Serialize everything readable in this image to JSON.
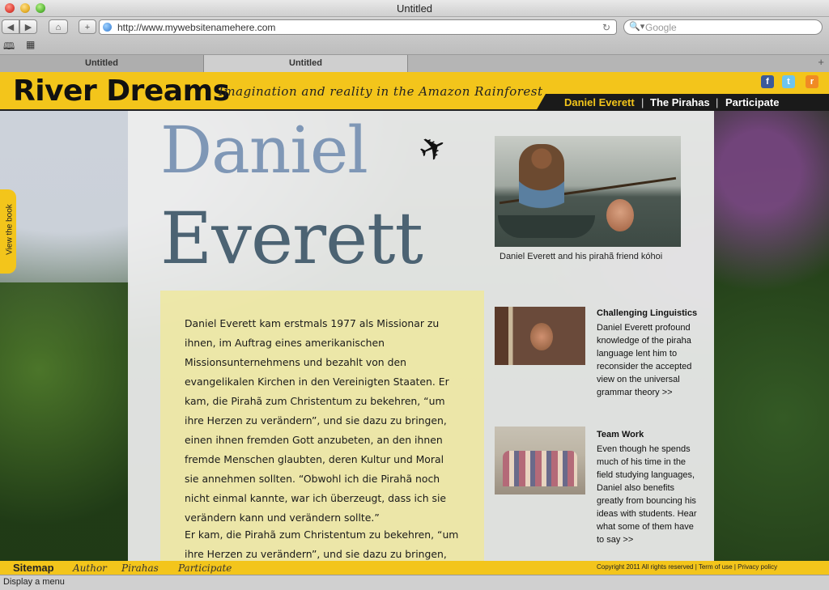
{
  "window": {
    "title": "Untitled"
  },
  "toolbar": {
    "back_icon": "back-arrow-icon",
    "forward_icon": "forward-arrow-icon",
    "home_icon": "home-icon",
    "add_icon": "plus-icon",
    "url": "http://www.mywebsitenamehere.com",
    "search_placeholder": "Google"
  },
  "tabs": [
    {
      "label": "Untitled"
    },
    {
      "label": "Untitled"
    }
  ],
  "site": {
    "logo": "River Dreams",
    "tagline": "Imagination and reality in the Amazon Rainforest",
    "social": {
      "facebook": "f",
      "twitter": "t",
      "rss": "r"
    },
    "nav": [
      {
        "label": "Daniel Everett",
        "color": "#f3c51b"
      },
      {
        "label": "The Pirahas",
        "color": "#ffffff"
      },
      {
        "label": "Participate",
        "color": "#ffffff"
      }
    ],
    "nav_separator": "|",
    "book_tab": "View the book"
  },
  "main": {
    "name_line1": "Daniel",
    "name_line2": "Everett",
    "paragraph1": "Daniel Everett kam erstmals 1977 als Missionar zu ihnen, im Auftrag eines amerikanischen Missionsunternehmens und bezahlt von den evangelikalen Kirchen in den Vereinigten Staaten. Er kam, die Pirahã zum Christentum zu bekehren, “um ihre Herzen zu verändern”, und sie dazu zu bringen, einen ihnen fremden Gott anzubeten, an den ihnen fremde Menschen glaubten, deren Kultur und Moral sie annehmen sollten. “Obwohl ich die Pirahã noch nicht einmal kannte, war ich überzeugt, dass ich sie verändern kann und verändern sollte.”",
    "paragraph2": "Er kam, die Pirahã zum Christentum zu bekehren, “um ihre Herzen zu verändern”, und sie dazu zu bringen, einen ihnen",
    "photo_caption": "Daniel Everett and his pirahã friend kóhoi",
    "sidebar": [
      {
        "title": "Challenging Linguistics",
        "text": "Daniel Everett profound knowledge of the piraha language lent him to reconsider the accepted view on the universal grammar theory >>"
      },
      {
        "title": "Team Work",
        "text": "Even though he spends much of his time in the field studying languages, Daniel also benefits greatly from bouncing his ideas with students. Hear what some of them have to say >>"
      }
    ]
  },
  "footer": {
    "sitemap": "Sitemap",
    "links": [
      "Author",
      "Pirahas",
      "Participate"
    ],
    "copyright": "Copyright 2011 All rights reserved | Term of use | Privacy policy"
  },
  "status": {
    "text": "Display a menu"
  },
  "colors": {
    "accent": "#f3c51b",
    "header_dark": "#1a1a1a"
  }
}
